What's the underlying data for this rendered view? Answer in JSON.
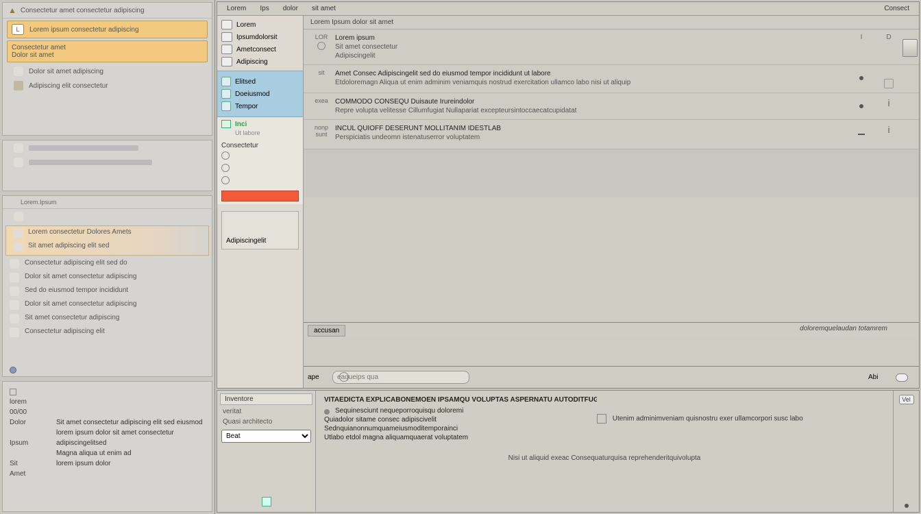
{
  "leftcol": {
    "p1": {
      "header": "Consectetur amet consectetur adipiscing",
      "hl1": "Lorem ipsum consectetur adipiscing",
      "hl1_badge": "L",
      "hl2a": "Consectetur amet",
      "hl2b": "Dolor sit amet",
      "row3": "Dolor sit amet adipiscing",
      "row4": "Adipiscing elit consectetur"
    },
    "p3": {
      "tab": "Lorem.Ipsum",
      "g1a": "Lorem consectetur Dolores  Amets",
      "g1b": "Sit amet adipiscing elit sed",
      "items": [
        "Consectetur adipiscing elit sed do",
        "Dolor sit amet consectetur adipiscing",
        "Sed do eiusmod tempor incididunt",
        "Dolor sit amet consectetur adipiscing",
        "Sit amet consectetur adipiscing",
        "Consectetur adipiscing elit"
      ]
    },
    "p4": {
      "rows": [
        {
          "l": "lorem",
          "v": ""
        },
        {
          "l": "00/00",
          "v": ""
        },
        {
          "l": "Dolor",
          "v": "Sit amet  consectetur adipiscing elit sed  eiusmod"
        },
        {
          "l": "",
          "v": "lorem ipsum dolor sit amet  consectetur"
        },
        {
          "l": "Ipsum",
          "v": "adipiscingelitsed"
        },
        {
          "l": "",
          "v": "Magna aliqua ut enim ad"
        },
        {
          "l": "Sit",
          "v": "lorem ipsum dolor"
        },
        {
          "l": "Amet",
          "v": ""
        }
      ]
    }
  },
  "top": {
    "tabs": {
      "a": "Lorem",
      "b": "Ips",
      "c": "dolor",
      "d": "sit amet",
      "right": "Consect"
    },
    "title": "Lorem  Ipsum dolor sit amet",
    "nav": {
      "sec1": [
        "Lorem",
        "Ipsumdolorsit",
        "Ametconsect",
        "Adipiscing"
      ],
      "sec2": [
        "Elitsed",
        "Doeiusmod",
        "Tempor"
      ],
      "sec3_title": "Inci",
      "sec3_sub": "Ut labore",
      "sec3_cat": "Consectetur",
      "sec3_items": [
        "",
        "",
        ""
      ],
      "card": "Adipiscingelit"
    },
    "list": [
      {
        "col1a": "LOR",
        "col1b": "circ",
        "lines": [
          "Lorem  ipsum",
          "Sit amet consectetur",
          "Adipiscingelit"
        ],
        "c3": "I",
        "c4": "D"
      },
      {
        "col1a": "sit",
        "lines": [
          "Amet  Consec   Adipiscingelit  sed do  eiusmod  tempor  incididunt ut  labore",
          "Etdoloremagn   Aliqua ut enim adminim  veniamquis nostrud exercitation ullamco labo  nisi ut aliquip"
        ],
        "c3": "",
        "mark": true
      },
      {
        "col1a": "exea",
        "lines": [
          "COMMODO CONSEQU   Duisaute  Irureindolor",
          "Repre  volupta   velitesse  Cillumfugiat   Nullapariat    excepteursintoccaecatcupidatat"
        ],
        "c3": "",
        "mark": true
      },
      {
        "col1a": "nonp",
        "col1b": "sunt",
        "lines": [
          "INCUL QUIOFF  DESERUNT  MOLLITANIM  IDESTLAB",
          "Perspiciatis   undeomn  istenatuserror  voluptatem"
        ],
        "c3": "",
        "mark": true
      }
    ],
    "tabsbar": {
      "left": "accusan",
      "right": "doloremquelaudan totamrem"
    },
    "search": {
      "left": "ape",
      "placeholder": "eaqueips qua",
      "right": "Abi",
      "righticon": true
    }
  },
  "bottom": {
    "nav": {
      "title": "Inventore",
      "l1": "veritat",
      "l2": "Quasi architecto",
      "combo": "Beat"
    },
    "body": {
      "header": "VITAEDICTA EXPLICABONEMOEN   IPSAMQU  VOLUPTAS ASPERNATU  AUTODITFUGI CONSE MAGNIDOLORES  EOSRATIONES",
      "lines": [
        "Sequinesciunt nequeporroquisqu doloremi",
        "Quiadolor sitame  consec  adipiscivelit",
        "Sednquianonnumquameiusmoditemporainci",
        "Utlabo etdol  magna aliquamquaerat voluptatem"
      ],
      "sideline": "Utenim adminimveniam quisnostru exer ullamcorpori susc labo",
      "footer": "Nisi ut aliquid  exeac  Consequaturquisa  reprehenderitquivolupta"
    },
    "badge": "Vel"
  }
}
